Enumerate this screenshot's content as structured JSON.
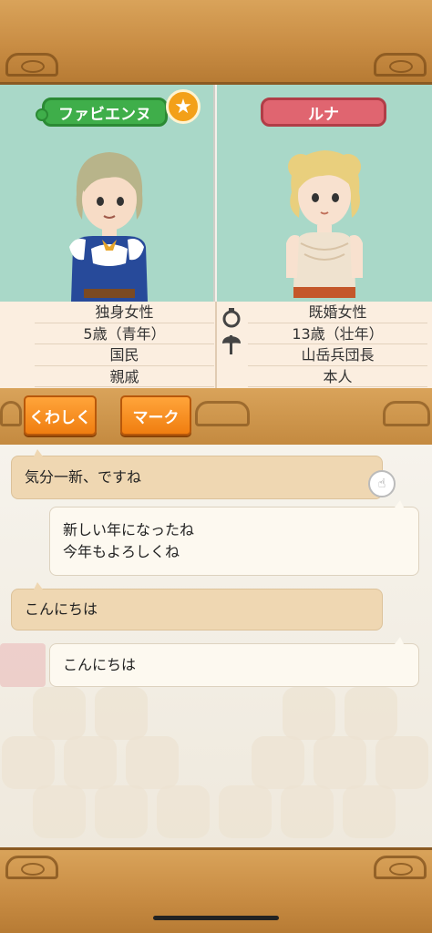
{
  "colors": {
    "wood": "#c98d44",
    "teal_bg": "#a9d8c8",
    "name_green": "#3fae4a",
    "name_red": "#e06570",
    "button_orange": "#f07e10",
    "bubble_incoming": "#efd7b2",
    "bubble_outgoing": "#fdf9f0"
  },
  "left_character": {
    "name": "ファビエンヌ",
    "badge_icon": "star-icon",
    "badge_glyph": "★",
    "info": [
      "独身女性",
      "5歳（青年）",
      "国民",
      "親戚"
    ]
  },
  "right_character": {
    "name": "ルナ",
    "icons": [
      "ring-icon",
      "axe-icon"
    ],
    "info": [
      "既婚女性",
      "13歳（壮年）",
      "山岳兵団長",
      "本人"
    ]
  },
  "buttons": {
    "detail": "くわしく",
    "mark": "マーク"
  },
  "chat": [
    {
      "side": "incoming",
      "lines": [
        "気分一新、ですね"
      ]
    },
    {
      "side": "outgoing",
      "lines": [
        "新しい年になったね",
        "今年もよろしくね"
      ]
    },
    {
      "side": "incoming",
      "lines": [
        "こんにちは"
      ]
    },
    {
      "side": "outgoing",
      "lines": [
        "こんにちは"
      ]
    }
  ]
}
